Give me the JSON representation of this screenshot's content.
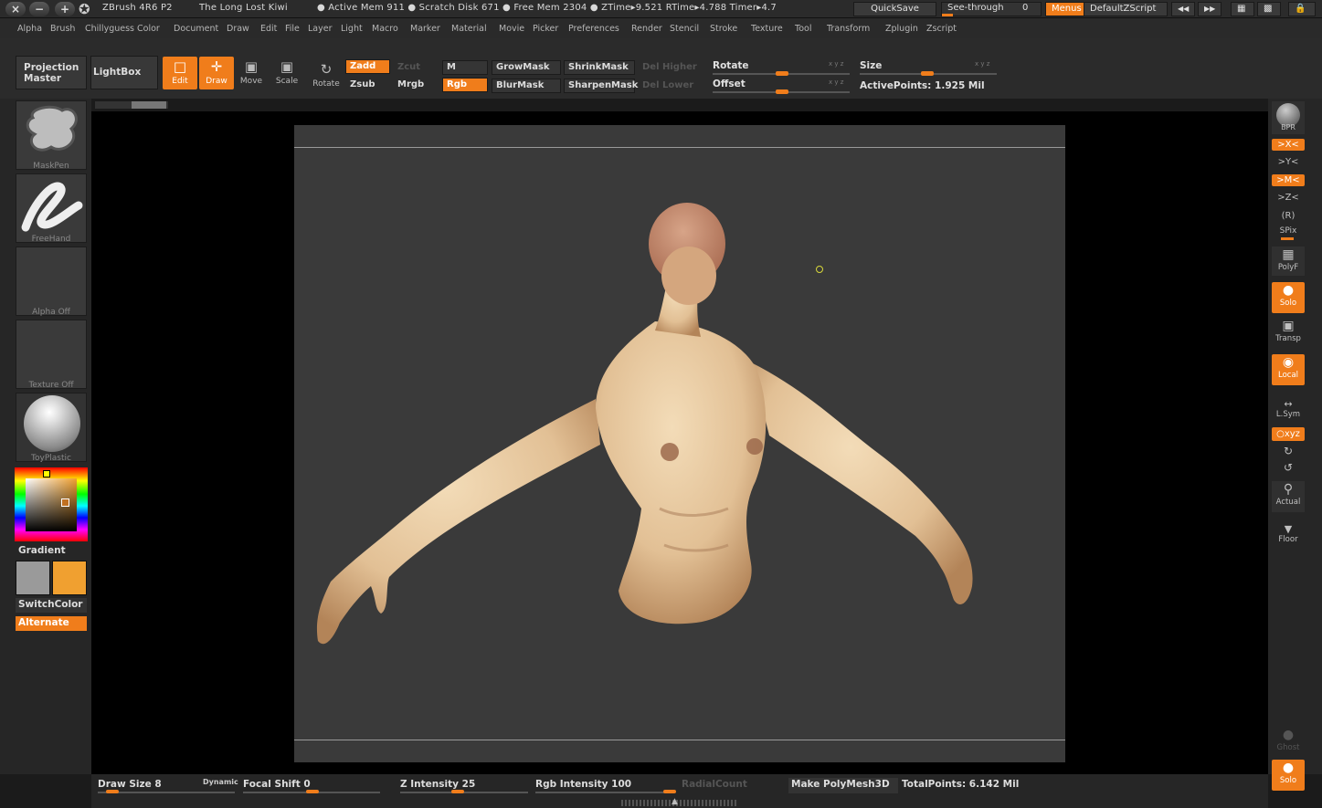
{
  "titlebar": {
    "app": "ZBrush 4R6 P2",
    "project": "The Long Lost Kiwi",
    "stats": "● Active Mem 911  ● Scratch Disk 671  ● Free Mem 2304  ● ZTime▸9.521 RTime▸4.788 Timer▸4.7",
    "quicksave": "QuickSave",
    "see_through_label": "See-through",
    "see_through_value": "0",
    "menus": "Menus",
    "script": "DefaultZScript"
  },
  "menu": [
    "Alpha",
    "Brush",
    "Chillyguess",
    "Color",
    "Document",
    "Draw",
    "Edit",
    "File",
    "Layer",
    "Light",
    "Macro",
    "Marker",
    "Material",
    "Movie",
    "Picker",
    "Preferences",
    "Render",
    "Stencil",
    "Stroke",
    "Texture",
    "Tool",
    "Transform",
    "Zplugin",
    "Zscript"
  ],
  "shelf": {
    "projection_master": [
      "Projection",
      "Master"
    ],
    "lightbox": "LightBox",
    "tools": {
      "edit": "Edit",
      "draw": "Draw",
      "move": "Move",
      "scale": "Scale",
      "rotate": "Rotate"
    },
    "zadd": "Zadd",
    "zcut": "Zcut",
    "zsub": "Zsub",
    "m": "M",
    "mrgb": "Mrgb",
    "rgb": "Rgb",
    "growmask": "GrowMask",
    "shrinkmask": "ShrinkMask",
    "blurmask": "BlurMask",
    "sharpenmask": "SharpenMask",
    "del_higher": "Del Higher",
    "del_lower": "Del Lower",
    "rotate": "Rotate",
    "offset": "Offset",
    "xyz": "x y z",
    "size": "Size",
    "active_points": "ActivePoints: 1.925 Mil"
  },
  "left": {
    "brush": "MaskPen",
    "stroke": "FreeHand",
    "alpha": "Alpha  Off",
    "texture": "Texture  Off",
    "material": "ToyPlastic",
    "gradient": "Gradient",
    "switchcolor": "SwitchColor",
    "alternate": "Alternate",
    "primary_color": "#9a9a9a",
    "secondary_color": "#f0a030"
  },
  "right": {
    "bpr": "BPR",
    "x": ">X<",
    "y": ">Y<",
    "m": ">M<",
    "z": ">Z<",
    "r": "(R)",
    "spix": "SPix",
    "polyf": "PolyF",
    "solo": "Solo",
    "transp": "Transp",
    "local": "Local",
    "lsym": "L.Sym",
    "xyz": "○xyz",
    "actual": "Actual",
    "floor": "Floor",
    "ghost": "Ghost",
    "solo2": "Solo"
  },
  "bottom": {
    "draw_size": "Draw  Size 8",
    "dynamic": "Dynamic",
    "focal_shift": "Focal  Shift 0",
    "z_intensity": "Z  Intensity 25",
    "rgb_intensity": "Rgb  Intensity 100",
    "radial_count": "RadialCount",
    "make_polymesh": "Make PolyMesh3D",
    "total_points": "TotalPoints: 6.142  Mil"
  }
}
